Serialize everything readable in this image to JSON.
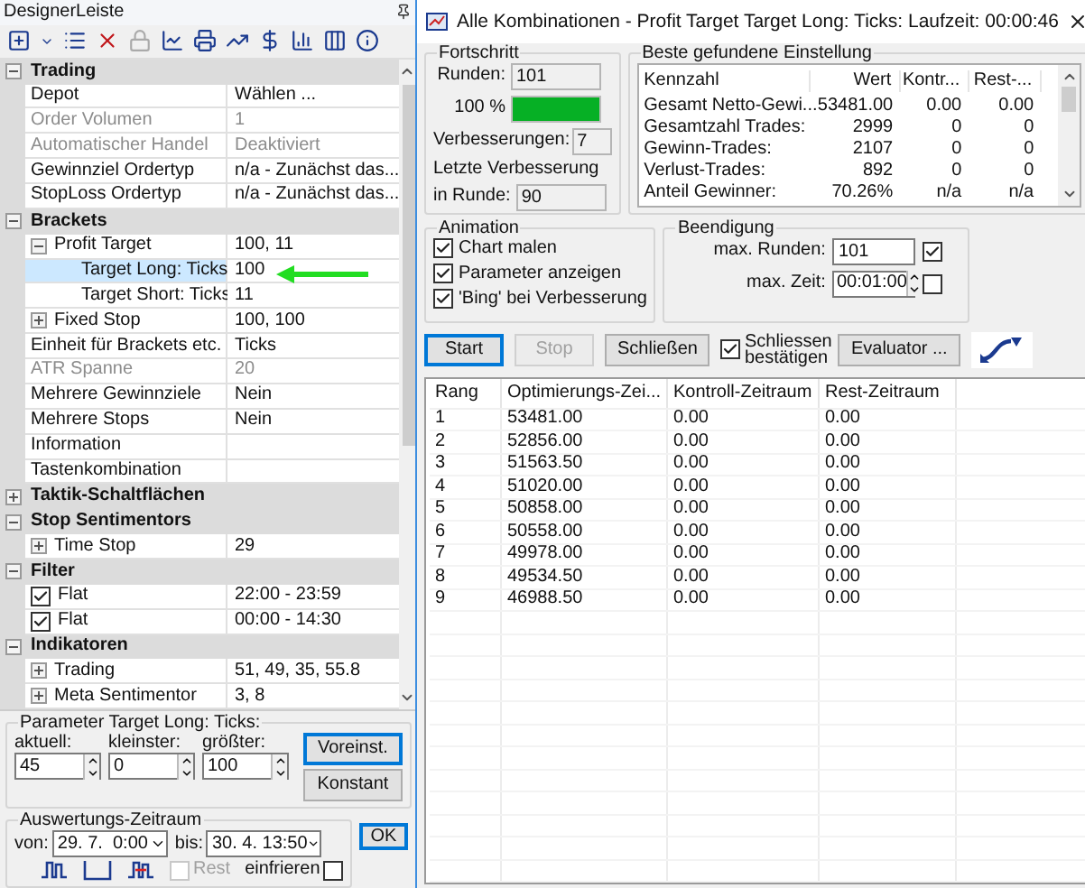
{
  "designer": {
    "title": "DesignerLeiste",
    "properties": [
      {
        "kind": "category",
        "label": "Trading",
        "expanded": true,
        "children": [
          {
            "kind": "property",
            "label": "Depot",
            "value": "Wählen ...",
            "disabled": false,
            "selected": false
          },
          {
            "kind": "property",
            "label": "Order Volumen",
            "value": "1",
            "disabled": true,
            "selected": false
          },
          {
            "kind": "property",
            "label": "Automatischer Handel",
            "value": "Deaktiviert",
            "disabled": true,
            "selected": false
          },
          {
            "kind": "property",
            "label": "Gewinnziel Ordertyp",
            "value": "n/a - Zunächst das...",
            "disabled": false,
            "selected": false
          },
          {
            "kind": "property",
            "label": "StopLoss Ordertyp",
            "value": "n/a - Zunächst das...",
            "disabled": false,
            "selected": false
          }
        ]
      },
      {
        "kind": "category",
        "label": "Brackets",
        "expanded": true,
        "children": [
          {
            "kind": "group",
            "label": "Profit Target",
            "value": "100, 11",
            "expanded": true,
            "selected": false,
            "children": [
              {
                "kind": "property",
                "label": "Target Long: Ticks",
                "value": "100",
                "disabled": false,
                "selected": true
              },
              {
                "kind": "property",
                "label": "Target Short: Ticks",
                "value": "11",
                "disabled": false,
                "selected": false
              }
            ]
          },
          {
            "kind": "group",
            "label": "Fixed Stop",
            "value": "100, 100",
            "expanded": false,
            "selected": false
          },
          {
            "kind": "property",
            "label": "Einheit für Brackets etc.",
            "value": "Ticks",
            "disabled": false,
            "selected": false
          },
          {
            "kind": "property",
            "label": "ATR Spanne",
            "value": "20",
            "disabled": true,
            "selected": false
          },
          {
            "kind": "property",
            "label": "Mehrere Gewinnziele",
            "value": "Nein",
            "disabled": false,
            "selected": false
          },
          {
            "kind": "property",
            "label": "Mehrere Stops",
            "value": "Nein",
            "disabled": false,
            "selected": false
          },
          {
            "kind": "property",
            "label": "Information",
            "disabled": false,
            "selected": false
          },
          {
            "kind": "property",
            "label": "Tastenkombination",
            "disabled": false,
            "selected": false
          }
        ]
      },
      {
        "kind": "category",
        "label": "Taktik-Schaltflächen",
        "expanded": false
      },
      {
        "kind": "category",
        "label": "Stop Sentimentors",
        "expanded": true,
        "children": [
          {
            "kind": "group",
            "label": "Time Stop",
            "value": "29",
            "expanded": false,
            "selected": false
          }
        ]
      },
      {
        "kind": "category",
        "label": "Filter",
        "expanded": true,
        "children": [
          {
            "kind": "checkbox",
            "label": "Flat",
            "value": "22:00 - 23:59",
            "checked": true,
            "selected": false
          },
          {
            "kind": "checkbox",
            "label": "Flat",
            "value": "00:00 - 14:30",
            "checked": true,
            "selected": false
          }
        ]
      },
      {
        "kind": "category",
        "label": "Indikatoren",
        "expanded": true,
        "children": [
          {
            "kind": "group",
            "label": "Trading",
            "value": "51, 49, 35, 55.8",
            "expanded": false,
            "selected": false
          },
          {
            "kind": "group",
            "label": "Meta Sentimentor",
            "value": "3, 8",
            "expanded": false,
            "selected": false
          }
        ]
      }
    ],
    "parameter": {
      "title": "Parameter Target Long: Ticks:",
      "fields": [
        {
          "label": "aktuell:",
          "value": "45"
        },
        {
          "label": "kleinster:",
          "value": "0"
        },
        {
          "label": "größter:",
          "value": "100"
        }
      ],
      "buttons": [
        {
          "label": "Voreinst.",
          "default": true
        },
        {
          "label": "Konstant",
          "default": false
        }
      ]
    },
    "period": {
      "title": "Auswertungs-Zeitraum",
      "from_label": "von:",
      "from": "29. 7.  0:00",
      "to_label": "bis:",
      "to": "30. 4. 13:50",
      "rest": {
        "label": "Rest",
        "checked": false,
        "disabled": true
      },
      "freeze": {
        "label": "einfrieren",
        "checked": false
      }
    },
    "ok_button": "OK"
  },
  "optimizer": {
    "title": "Alle Kombinationen - Profit Target Target Long: Ticks: Laufzeit: 00:00:46",
    "progress": {
      "title": "Fortschritt",
      "rounds_label": "Runden:",
      "rounds": "101",
      "percent": "100 %",
      "level": 1,
      "improvements_label": "Verbesserungen:",
      "improvements": "7",
      "last_label": "Letzte Verbesserung",
      "last_round_label": "in Runde:",
      "last_round": "90"
    },
    "best": {
      "title": "Beste gefundene Einstellung",
      "columns": [
        "Kennzahl",
        "Wert",
        "Kontr...",
        "Rest-..."
      ],
      "rows": [
        [
          "Gesamt Netto-Gewi...",
          "53481.00",
          "0.00",
          "0.00"
        ],
        [
          "Gesamtzahl Trades:",
          "2999",
          "0",
          "0"
        ],
        [
          "Gewinn-Trades:",
          "2107",
          "0",
          "0"
        ],
        [
          "Verlust-Trades:",
          "892",
          "0",
          "0"
        ],
        [
          "Anteil Gewinner:",
          "70.26%",
          "n/a",
          "n/a"
        ]
      ]
    },
    "animation": {
      "title": "Animation",
      "options": [
        {
          "label": "Chart malen",
          "checked": true
        },
        {
          "label": "Parameter anzeigen",
          "checked": true
        },
        {
          "label": "'Bing' bei Verbesserung",
          "checked": true
        }
      ]
    },
    "termination": {
      "title": "Beendigung",
      "max_rounds_label": "max. Runden:",
      "max_rounds": "101",
      "max_rounds_on": true,
      "max_time_label": "max. Zeit:",
      "max_time": "00:01:00",
      "max_time_on": false
    },
    "actions": [
      {
        "kind": "button",
        "label": "Start",
        "default": true,
        "disabled": false
      },
      {
        "kind": "button",
        "label": "Stop",
        "default": false,
        "disabled": true
      },
      {
        "kind": "button",
        "label": "Schließen",
        "default": false,
        "disabled": false
      },
      {
        "kind": "checkbox",
        "label": "Schliessen bestätigen",
        "checked": true
      },
      {
        "kind": "button",
        "label": "Evaluator ...",
        "default": false,
        "disabled": false
      }
    ],
    "results": {
      "columns": [
        "Rang",
        "Optimierungs-Zei...",
        "Kontroll-Zeitraum",
        "Rest-Zeitraum"
      ],
      "rows": [
        [
          "1",
          "53481.00",
          "0.00",
          "0.00"
        ],
        [
          "2",
          "52856.00",
          "0.00",
          "0.00"
        ],
        [
          "3",
          "51563.50",
          "0.00",
          "0.00"
        ],
        [
          "4",
          "51020.00",
          "0.00",
          "0.00"
        ],
        [
          "5",
          "50858.00",
          "0.00",
          "0.00"
        ],
        [
          "6",
          "50558.00",
          "0.00",
          "0.00"
        ],
        [
          "7",
          "49978.00",
          "0.00",
          "0.00"
        ],
        [
          "8",
          "49534.50",
          "0.00",
          "0.00"
        ],
        [
          "9",
          "46988.50",
          "0.00",
          "0.00"
        ]
      ]
    }
  }
}
